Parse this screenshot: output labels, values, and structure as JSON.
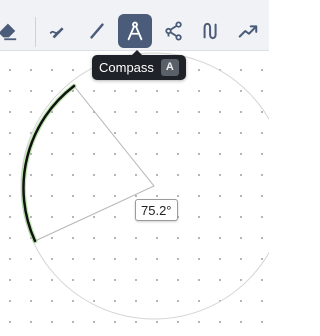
{
  "toolbar": {
    "tools": [
      {
        "id": "eraser",
        "icon": "eraser-icon",
        "active": false
      },
      {
        "id": "pen",
        "icon": "pen-icon",
        "active": false
      },
      {
        "id": "line",
        "icon": "line-icon",
        "active": false
      },
      {
        "id": "compass",
        "icon": "compass-icon",
        "active": true
      },
      {
        "id": "polyline",
        "icon": "polyline-icon",
        "active": false
      },
      {
        "id": "curve",
        "icon": "curve-icon",
        "active": false
      },
      {
        "id": "trend",
        "icon": "trend-icon",
        "active": false
      }
    ]
  },
  "tooltip": {
    "label": "Compass",
    "shortcut": "A"
  },
  "canvas": {
    "angle_label": "75.2°"
  },
  "colors": {
    "toolbar_bg": "#f1f2f5",
    "active_tool_bg": "#4a5c79",
    "icon": "#4a5c79",
    "arc_stroke": "#111111",
    "arc_highlight": "#8bd36f",
    "circle_guide": "#d4d4d4",
    "grid_dot": "#9e9e9e"
  }
}
